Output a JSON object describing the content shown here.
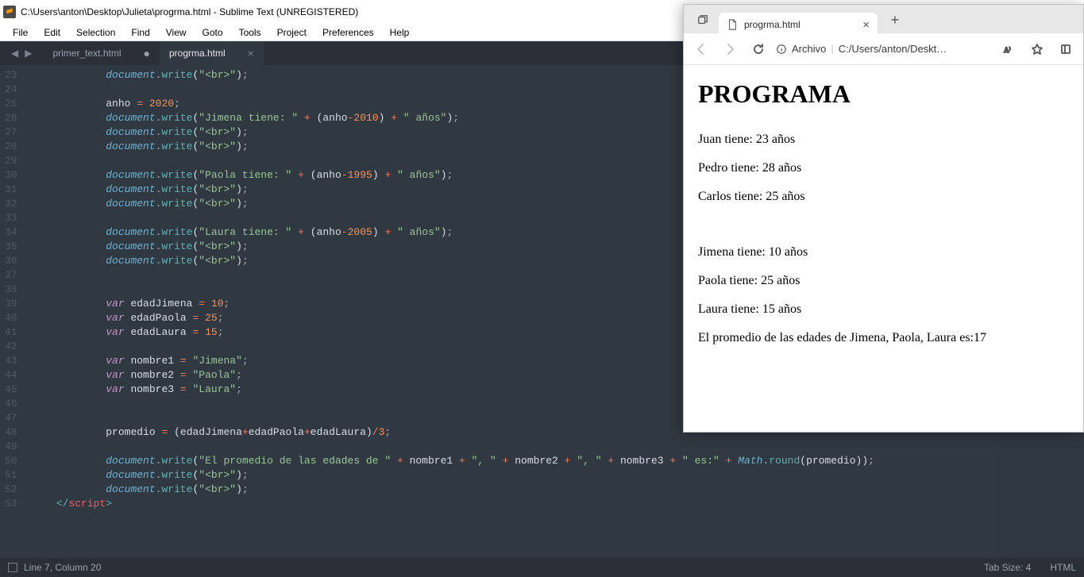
{
  "sublime": {
    "title": "C:\\Users\\anton\\Desktop\\Julieta\\progrma.html - Sublime Text (UNREGISTERED)",
    "menu": [
      "File",
      "Edit",
      "Selection",
      "Find",
      "View",
      "Goto",
      "Tools",
      "Project",
      "Preferences",
      "Help"
    ],
    "tabs": [
      {
        "label": "primer_text.html",
        "active": false,
        "changed": true
      },
      {
        "label": "progrma.html",
        "active": true,
        "changed": false
      }
    ],
    "code": {
      "first_line": 23,
      "lines": [
        [
          [
            "obj",
            "document"
          ],
          [
            "punc",
            "."
          ],
          [
            "fn",
            "write"
          ],
          [
            "paren",
            "("
          ],
          [
            "str",
            "\"<br>\""
          ],
          [
            "paren",
            ")"
          ],
          [
            "punc",
            ";"
          ]
        ],
        [],
        [
          [
            "var",
            "anho "
          ],
          [
            "op",
            "="
          ],
          [
            "var",
            " "
          ],
          [
            "num",
            "2020"
          ],
          [
            "punc",
            ";"
          ]
        ],
        [
          [
            "obj",
            "document"
          ],
          [
            "punc",
            "."
          ],
          [
            "fn",
            "write"
          ],
          [
            "paren",
            "("
          ],
          [
            "str",
            "\"Jimena tiene: \""
          ],
          [
            "var",
            " "
          ],
          [
            "op",
            "+"
          ],
          [
            "var",
            " "
          ],
          [
            "paren",
            "("
          ],
          [
            "var",
            "anho"
          ],
          [
            "op",
            "-"
          ],
          [
            "num",
            "2010"
          ],
          [
            "paren",
            ")"
          ],
          [
            "var",
            " "
          ],
          [
            "op",
            "+"
          ],
          [
            "var",
            " "
          ],
          [
            "str",
            "\" años\""
          ],
          [
            "paren",
            ")"
          ],
          [
            "punc",
            ";"
          ]
        ],
        [
          [
            "obj",
            "document"
          ],
          [
            "punc",
            "."
          ],
          [
            "fn",
            "write"
          ],
          [
            "paren",
            "("
          ],
          [
            "str",
            "\"<br>\""
          ],
          [
            "paren",
            ")"
          ],
          [
            "punc",
            ";"
          ]
        ],
        [
          [
            "obj",
            "document"
          ],
          [
            "punc",
            "."
          ],
          [
            "fn",
            "write"
          ],
          [
            "paren",
            "("
          ],
          [
            "str",
            "\"<br>\""
          ],
          [
            "paren",
            ")"
          ],
          [
            "punc",
            ";"
          ]
        ],
        [],
        [
          [
            "obj",
            "document"
          ],
          [
            "punc",
            "."
          ],
          [
            "fn",
            "write"
          ],
          [
            "paren",
            "("
          ],
          [
            "str",
            "\"Paola tiene: \""
          ],
          [
            "var",
            " "
          ],
          [
            "op",
            "+"
          ],
          [
            "var",
            " "
          ],
          [
            "paren",
            "("
          ],
          [
            "var",
            "anho"
          ],
          [
            "op",
            "-"
          ],
          [
            "num",
            "1995"
          ],
          [
            "paren",
            ")"
          ],
          [
            "var",
            " "
          ],
          [
            "op",
            "+"
          ],
          [
            "var",
            " "
          ],
          [
            "str",
            "\" años\""
          ],
          [
            "paren",
            ")"
          ],
          [
            "punc",
            ";"
          ]
        ],
        [
          [
            "obj",
            "document"
          ],
          [
            "punc",
            "."
          ],
          [
            "fn",
            "write"
          ],
          [
            "paren",
            "("
          ],
          [
            "str",
            "\"<br>\""
          ],
          [
            "paren",
            ")"
          ],
          [
            "punc",
            ";"
          ]
        ],
        [
          [
            "obj",
            "document"
          ],
          [
            "punc",
            "."
          ],
          [
            "fn",
            "write"
          ],
          [
            "paren",
            "("
          ],
          [
            "str",
            "\"<br>\""
          ],
          [
            "paren",
            ")"
          ],
          [
            "punc",
            ";"
          ]
        ],
        [],
        [
          [
            "obj",
            "document"
          ],
          [
            "punc",
            "."
          ],
          [
            "fn",
            "write"
          ],
          [
            "paren",
            "("
          ],
          [
            "str",
            "\"Laura tiene: \""
          ],
          [
            "var",
            " "
          ],
          [
            "op",
            "+"
          ],
          [
            "var",
            " "
          ],
          [
            "paren",
            "("
          ],
          [
            "var",
            "anho"
          ],
          [
            "op",
            "-"
          ],
          [
            "num",
            "2005"
          ],
          [
            "paren",
            ")"
          ],
          [
            "var",
            " "
          ],
          [
            "op",
            "+"
          ],
          [
            "var",
            " "
          ],
          [
            "str",
            "\" años\""
          ],
          [
            "paren",
            ")"
          ],
          [
            "punc",
            ";"
          ]
        ],
        [
          [
            "obj",
            "document"
          ],
          [
            "punc",
            "."
          ],
          [
            "fn",
            "write"
          ],
          [
            "paren",
            "("
          ],
          [
            "str",
            "\"<br>\""
          ],
          [
            "paren",
            ")"
          ],
          [
            "punc",
            ";"
          ]
        ],
        [
          [
            "obj",
            "document"
          ],
          [
            "punc",
            "."
          ],
          [
            "fn",
            "write"
          ],
          [
            "paren",
            "("
          ],
          [
            "str",
            "\"<br>\""
          ],
          [
            "paren",
            ")"
          ],
          [
            "punc",
            ";"
          ]
        ],
        [],
        [],
        [
          [
            "kw",
            "var"
          ],
          [
            "var",
            " edadJimena "
          ],
          [
            "op",
            "="
          ],
          [
            "var",
            " "
          ],
          [
            "num",
            "10"
          ],
          [
            "punc",
            ";"
          ]
        ],
        [
          [
            "kw",
            "var"
          ],
          [
            "var",
            " edadPaola "
          ],
          [
            "op",
            "="
          ],
          [
            "var",
            " "
          ],
          [
            "num",
            "25"
          ],
          [
            "punc",
            ";"
          ]
        ],
        [
          [
            "kw",
            "var"
          ],
          [
            "var",
            " edadLaura "
          ],
          [
            "op",
            "="
          ],
          [
            "var",
            " "
          ],
          [
            "num",
            "15"
          ],
          [
            "punc",
            ";"
          ]
        ],
        [],
        [
          [
            "kw",
            "var"
          ],
          [
            "var",
            " nombre1 "
          ],
          [
            "op",
            "="
          ],
          [
            "var",
            " "
          ],
          [
            "str",
            "\"Jimena\""
          ],
          [
            "punc",
            ";"
          ]
        ],
        [
          [
            "kw",
            "var"
          ],
          [
            "var",
            " nombre2 "
          ],
          [
            "op",
            "="
          ],
          [
            "var",
            " "
          ],
          [
            "str",
            "\"Paola\""
          ],
          [
            "punc",
            ";"
          ]
        ],
        [
          [
            "kw",
            "var"
          ],
          [
            "var",
            " nombre3 "
          ],
          [
            "op",
            "="
          ],
          [
            "var",
            " "
          ],
          [
            "str",
            "\"Laura\""
          ],
          [
            "punc",
            ";"
          ]
        ],
        [],
        [],
        [
          [
            "var",
            "promedio "
          ],
          [
            "op",
            "="
          ],
          [
            "var",
            " "
          ],
          [
            "paren",
            "("
          ],
          [
            "var",
            "edadJimena"
          ],
          [
            "op",
            "+"
          ],
          [
            "var",
            "edadPaola"
          ],
          [
            "op",
            "+"
          ],
          [
            "var",
            "edadLaura"
          ],
          [
            "paren",
            ")"
          ],
          [
            "op",
            "/"
          ],
          [
            "num",
            "3"
          ],
          [
            "punc",
            ";"
          ]
        ],
        [],
        [
          [
            "obj",
            "document"
          ],
          [
            "punc",
            "."
          ],
          [
            "fn",
            "write"
          ],
          [
            "paren",
            "("
          ],
          [
            "str",
            "\"El promedio de las edades de \""
          ],
          [
            "var",
            " "
          ],
          [
            "op",
            "+"
          ],
          [
            "var",
            " nombre1 "
          ],
          [
            "op",
            "+"
          ],
          [
            "var",
            " "
          ],
          [
            "str",
            "\", \""
          ],
          [
            "var",
            " "
          ],
          [
            "op",
            "+"
          ],
          [
            "var",
            " nombre2 "
          ],
          [
            "op",
            "+"
          ],
          [
            "var",
            " "
          ],
          [
            "str",
            "\", \""
          ],
          [
            "var",
            " "
          ],
          [
            "op",
            "+"
          ],
          [
            "var",
            " nombre3 "
          ],
          [
            "op",
            "+"
          ],
          [
            "var",
            " "
          ],
          [
            "str",
            "\" es:\""
          ],
          [
            "var",
            " "
          ],
          [
            "op",
            "+"
          ],
          [
            "var",
            " "
          ],
          [
            "class",
            "Math"
          ],
          [
            "punc",
            "."
          ],
          [
            "fn",
            "round"
          ],
          [
            "paren",
            "("
          ],
          [
            "var",
            "promedio"
          ],
          [
            "paren",
            "))"
          ],
          [
            "punc",
            ";"
          ]
        ],
        [
          [
            "obj",
            "document"
          ],
          [
            "punc",
            "."
          ],
          [
            "fn",
            "write"
          ],
          [
            "paren",
            "("
          ],
          [
            "str",
            "\"<br>\""
          ],
          [
            "paren",
            ")"
          ],
          [
            "punc",
            ";"
          ]
        ],
        [
          [
            "obj",
            "document"
          ],
          [
            "punc",
            "."
          ],
          [
            "fn",
            "write"
          ],
          [
            "paren",
            "("
          ],
          [
            "str",
            "\"<br>\""
          ],
          [
            "paren",
            ")"
          ],
          [
            "punc",
            ";"
          ]
        ]
      ],
      "closing": [
        [
          "tagp",
          "</"
        ],
        [
          "tagn",
          "script"
        ],
        [
          "tagp",
          ">"
        ]
      ],
      "outdent_last": 1,
      "indent_unit": "        "
    },
    "status": {
      "pos": "Line 7, Column 20",
      "tabsize": "Tab Size: 4",
      "lang": "HTML"
    }
  },
  "browser": {
    "tab_title": "progrma.html",
    "addr_label": "Archivo",
    "addr_path": "C:/Users/anton/Deskt…",
    "page": {
      "heading": "PROGRAMA",
      "lines1": [
        "Juan tiene: 23 años",
        "Pedro tiene: 28 años",
        "Carlos tiene: 25 años"
      ],
      "lines2": [
        "Jimena tiene: 10 años",
        "Paola tiene: 25 años",
        "Laura tiene: 15 años"
      ],
      "avg": "El promedio de las edades de Jimena, Paola, Laura es:17"
    }
  }
}
